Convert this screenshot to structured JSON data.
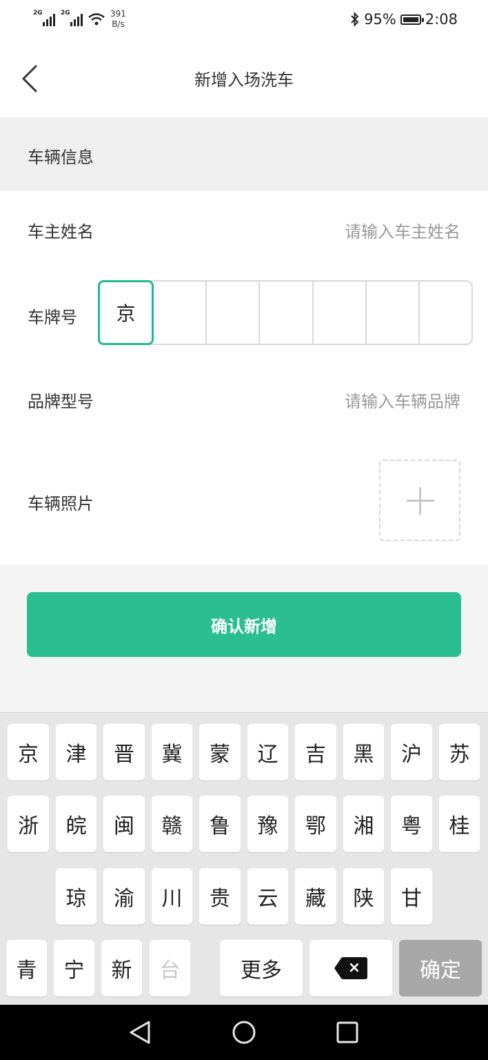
{
  "status_bar": {
    "signal1_label": "2G",
    "signal2_label": "2G",
    "net_speed_value": "391",
    "net_speed_unit": "B/s",
    "battery_percent": "95%",
    "time": "2:08",
    "battery_level": 0.95
  },
  "nav": {
    "title": "新增入场洗车"
  },
  "section": {
    "vehicle_info": "车辆信息"
  },
  "form": {
    "owner_name_label": "车主姓名",
    "owner_name_placeholder": "请输入车主姓名",
    "plate_label": "车牌号",
    "plate_cells": [
      "京",
      "",
      "",
      "",
      "",
      "",
      ""
    ],
    "brand_label": "品牌型号",
    "brand_placeholder": "请输入车辆品牌",
    "photo_label": "车辆照片"
  },
  "actions": {
    "confirm_add": "确认新增"
  },
  "keyboard": {
    "row1": [
      "京",
      "津",
      "晋",
      "冀",
      "蒙",
      "辽",
      "吉",
      "黑",
      "沪",
      "苏"
    ],
    "row2": [
      "浙",
      "皖",
      "闽",
      "赣",
      "鲁",
      "豫",
      "鄂",
      "湘",
      "粤",
      "桂"
    ],
    "row3": [
      "琼",
      "渝",
      "川",
      "贵",
      "云",
      "藏",
      "陕",
      "甘"
    ],
    "row4": [
      "青",
      "宁",
      "新",
      "台"
    ],
    "more": "更多",
    "ok": "确定"
  },
  "colors": {
    "accent": "#2bbf90",
    "active_cell_border": "#23b98d",
    "confirm_key": "#a7a7a7"
  }
}
